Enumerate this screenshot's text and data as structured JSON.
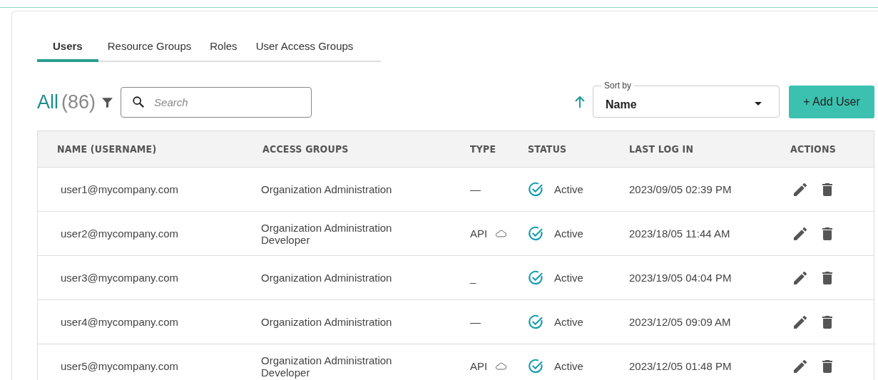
{
  "tabs": [
    {
      "label": "Users",
      "selected": true
    },
    {
      "label": "Resource Groups",
      "selected": false
    },
    {
      "label": "Roles",
      "selected": false
    },
    {
      "label": "User Access Groups",
      "selected": false
    }
  ],
  "toolbar": {
    "filter_label": "All",
    "count": "(86)",
    "search": {
      "placeholder": "Search"
    },
    "sort": {
      "label": "Sort by",
      "value": "Name"
    },
    "add_button": "+ Add User"
  },
  "table": {
    "columns": [
      "NAME (USERNAME)",
      "ACCESS GROUPS",
      "TYPE",
      "STATUS",
      "LAST LOG IN",
      "ACTIONS"
    ],
    "rows": [
      {
        "name": "user1@mycompany.com",
        "access_groups": [
          "Organization Administration"
        ],
        "type": "—",
        "cloud": false,
        "status": "Active",
        "last_log_in": "2023/09/05 02:39 PM"
      },
      {
        "name": "user2@mycompany.com",
        "access_groups": [
          "Organization Administration",
          "Developer"
        ],
        "type": "API",
        "cloud": true,
        "status": "Active",
        "last_log_in": "2023/18/05 11:44 AM"
      },
      {
        "name": "user3@mycompany.com",
        "access_groups": [
          "Organization Administration"
        ],
        "type": "_",
        "cloud": false,
        "status": "Active",
        "last_log_in": "2023/19/05 04:04 PM"
      },
      {
        "name": "user4@mycompany.com",
        "access_groups": [
          "Organization Administration"
        ],
        "type": "—",
        "cloud": false,
        "status": "Active",
        "last_log_in": "2023/12/05 09:09 AM"
      },
      {
        "name": "user5@mycompany.com",
        "access_groups": [
          "Organization Administration",
          "Developer"
        ],
        "type": "API",
        "cloud": true,
        "status": "Active",
        "last_log_in": "2023/12/05 01:48 PM"
      }
    ]
  }
}
